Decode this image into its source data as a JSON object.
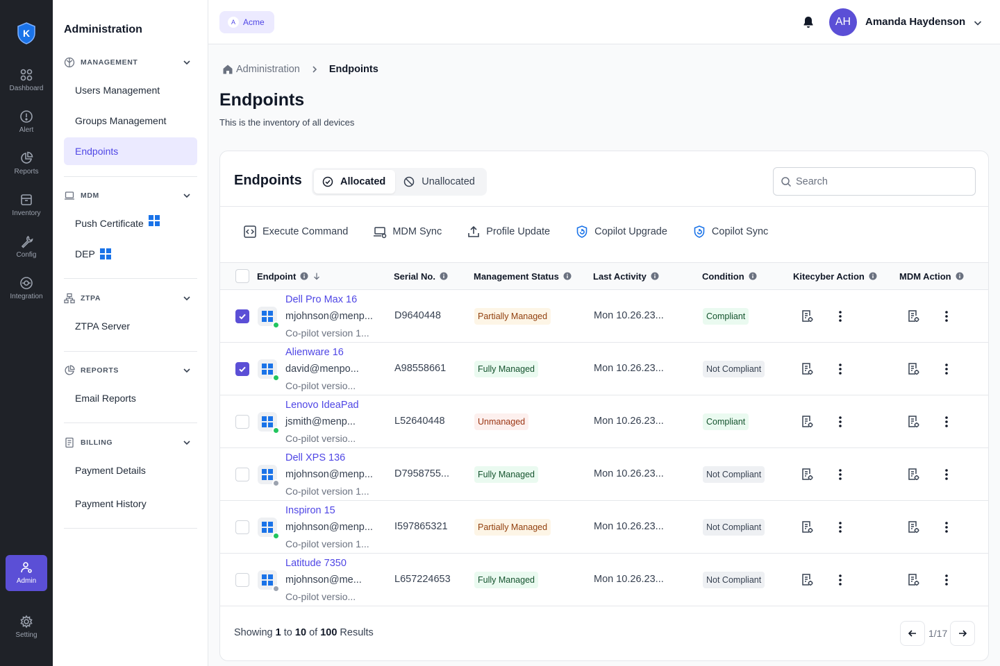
{
  "rail": {
    "items": [
      {
        "label": "Dashboard",
        "icon": "grid-icon"
      },
      {
        "label": "Alert",
        "icon": "alert-icon"
      },
      {
        "label": "Reports",
        "icon": "pie-chart-icon"
      },
      {
        "label": "Inventory",
        "icon": "archive-icon"
      },
      {
        "label": "Config",
        "icon": "wrench-icon"
      },
      {
        "label": "Integration",
        "icon": "integration-icon"
      }
    ],
    "admin": {
      "label": "Admin",
      "icon": "admin-icon"
    },
    "setting": {
      "label": "Setting",
      "icon": "gear-icon"
    },
    "logo_letter": "K"
  },
  "sidebar": {
    "title": "Administration",
    "sections": [
      {
        "title": "MANAGEMENT",
        "items": [
          "Users Management",
          "Groups Management",
          "Endpoints"
        ]
      },
      {
        "title": "MDM",
        "items": [
          "Push Certificate",
          "DEP"
        ]
      },
      {
        "title": "ZTPA",
        "items": [
          "ZTPA Server"
        ]
      },
      {
        "title": "REPORTS",
        "items": [
          "Email Reports"
        ]
      },
      {
        "title": "BILLING",
        "items": [
          "Payment Details",
          "Payment History"
        ]
      }
    ],
    "active_item": "Endpoints"
  },
  "topbar": {
    "org_name": "Acme",
    "org_initial": "A",
    "user_initials": "AH",
    "user_name": "Amanda Haydenson"
  },
  "breadcrumb": {
    "parent": "Administration",
    "current": "Endpoints"
  },
  "page": {
    "title": "Endpoints",
    "subtitle": "This is the inventory of all devices"
  },
  "card": {
    "title": "Endpoints",
    "tabs": [
      {
        "label": "Allocated",
        "active": true
      },
      {
        "label": "Unallocated",
        "active": false
      }
    ],
    "search_placeholder": "Search",
    "actions": [
      "Execute Command",
      "MDM Sync",
      "Profile Update",
      "Copilot Upgrade",
      "Copilot Sync"
    ]
  },
  "table": {
    "columns": [
      "Endpoint",
      "Serial No.",
      "Management Status",
      "Last Activity",
      "Condition",
      "Kitecyber Action",
      "MDM Action"
    ],
    "rows": [
      {
        "name": "Dell Pro Max 16",
        "email": "mjohnson@menp...",
        "version": "Co-pilot version 1...",
        "serial": "D9640448",
        "mgmt": "Partially Managed",
        "last": "Mon 10.26.23...",
        "condition": "Compliant",
        "checked": true,
        "online": true
      },
      {
        "name": "Alienware 16",
        "email": "david@menpo...",
        "version": "Co-pilot versio...",
        "serial": "A98558661",
        "mgmt": "Fully Managed",
        "last": "Mon 10.26.23...",
        "condition": "Not Compliant",
        "checked": true,
        "online": true
      },
      {
        "name": "Lenovo IdeaPad",
        "email": "jsmith@menp...",
        "version": "Co-pilot versio...",
        "serial": "L52640448",
        "mgmt": "Unmanaged",
        "last": "Mon 10.26.23...",
        "condition": "Compliant",
        "checked": false,
        "online": true
      },
      {
        "name": "Dell XPS 136",
        "email": "mjohnson@menp...",
        "version": "Co-pilot version 1...",
        "serial": "D7958755...",
        "mgmt": "Fully Managed",
        "last": "Mon 10.26.23...",
        "condition": "Not Compliant",
        "checked": false,
        "online": false
      },
      {
        "name": "Inspiron 15",
        "email": "mjohnson@menp...",
        "version": "Co-pilot version 1...",
        "serial": "I597865321",
        "mgmt": "Partially Managed",
        "last": "Mon 10.26.23...",
        "condition": "Not Compliant",
        "checked": false,
        "online": true
      },
      {
        "name": "Latitude 7350",
        "email": "mjohnson@me...",
        "version": "Co-pilot versio...",
        "serial": "L657224653",
        "mgmt": "Fully Managed",
        "last": "Mon 10.26.23...",
        "condition": "Not Compliant",
        "checked": false,
        "online": false
      }
    ]
  },
  "footer": {
    "showing": "Showing",
    "from": "1",
    "to_word": "to",
    "to": "10",
    "of_word": "of",
    "total": "100",
    "results": "Results",
    "page_label": "1/17"
  },
  "colors": {
    "accent": "#5b4fd6",
    "link": "#4f46e5",
    "rail_bg": "#1f2228",
    "windows_blue": "#1a73e8"
  }
}
